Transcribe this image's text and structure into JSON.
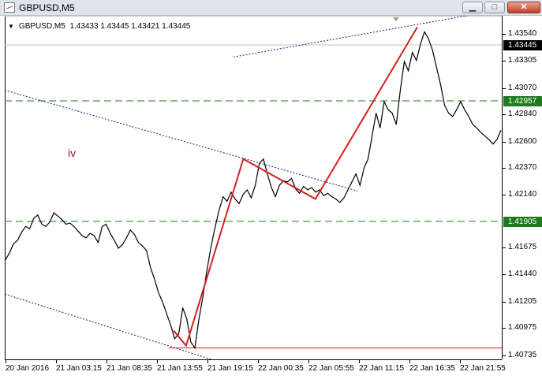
{
  "window": {
    "title": "GBPUSD,M5",
    "min_glyph": "▁",
    "max_glyph": "□",
    "close_glyph": "✕"
  },
  "info": {
    "symbol": "GBPUSD,M5",
    "ohlc": "1.43433 1.43445 1.43421 1.43445"
  },
  "annotation": {
    "wave": "iv"
  },
  "price_axis": {
    "levels": [
      "1.43540",
      "1.43305",
      "1.43070",
      "1.42840",
      "1.42600",
      "1.42370",
      "1.42140",
      "1.41675",
      "1.41440",
      "1.41205",
      "1.40975",
      "1.40735"
    ],
    "badges": [
      {
        "value": "1.43445",
        "bg": "#000000",
        "fg": "#ffffff"
      },
      {
        "value": "1.42957",
        "bg": "#1f7a1f",
        "fg": "#ffffff"
      },
      {
        "value": "1.41905",
        "bg": "#1f7a1f",
        "fg": "#ffffff"
      }
    ]
  },
  "time_axis": {
    "labels": [
      "20 Jan 2016",
      "21 Jan 03:15",
      "21 Jan 08:35",
      "21 Jan 13:55",
      "21 Jan 19:15",
      "22 Jan 00:35",
      "22 Jan 05:55",
      "22 Jan 11:15",
      "22 Jan 16:35",
      "22 Jan 21:55"
    ]
  },
  "colors": {
    "price_line": "#000000",
    "wave_line": "#d42020",
    "level_line": "#1f7a1f",
    "channel_line": "#1a1a8c",
    "support_line": "#d42020",
    "current_price_line": "#c0c0c0"
  },
  "chart_data": {
    "type": "line",
    "series": [
      {
        "values": [
          1.4157,
          1.4163,
          1.4171,
          1.4174,
          1.4181,
          1.4186,
          1.4184,
          1.4193,
          1.4196,
          1.4188,
          1.4186,
          1.419,
          1.4198,
          1.4195,
          1.4192,
          1.4188,
          1.4189,
          1.4186,
          1.4182,
          1.4178,
          1.4176,
          1.418,
          1.4178,
          1.4172,
          1.4186,
          1.4188,
          1.418,
          1.4174,
          1.4167,
          1.417,
          1.4176,
          1.4183,
          1.4179,
          1.4172,
          1.4169,
          1.4165,
          1.415,
          1.414,
          1.4128,
          1.412,
          1.411,
          1.41,
          1.4088,
          1.4092,
          1.4115,
          1.4105,
          1.4085,
          1.408,
          1.4105,
          1.4125,
          1.4148,
          1.4168,
          1.4185,
          1.42,
          1.4212,
          1.4208,
          1.4216,
          1.421,
          1.4206,
          1.4214,
          1.4218,
          1.4211,
          1.4222,
          1.4241,
          1.4245,
          1.4232,
          1.422,
          1.4212,
          1.4222,
          1.4226,
          1.4225,
          1.4228,
          1.4219,
          1.4215,
          1.4221,
          1.4218,
          1.422,
          1.4216,
          1.4218,
          1.4213,
          1.4215,
          1.4212,
          1.421,
          1.4207,
          1.4211,
          1.4218,
          1.4225,
          1.4232,
          1.4222,
          1.4237,
          1.4245,
          1.4265,
          1.4285,
          1.4272,
          1.4295,
          1.4288,
          1.4285,
          1.4275,
          1.4305,
          1.433,
          1.4322,
          1.4338,
          1.4331,
          1.4345,
          1.4356,
          1.435,
          1.434,
          1.4325,
          1.431,
          1.4292,
          1.4285,
          1.4282,
          1.4288,
          1.4295,
          1.4288,
          1.4282,
          1.4275,
          1.4272,
          1.4268,
          1.4265,
          1.4262,
          1.4258,
          1.4262,
          1.427
        ]
      }
    ],
    "ylim": [
      1.407,
      1.437
    ],
    "overlays": {
      "wave_points": [
        [
          0.34,
          1.4095
        ],
        [
          0.365,
          1.4082
        ],
        [
          0.48,
          1.4245
        ],
        [
          0.625,
          1.421
        ],
        [
          0.83,
          1.436
        ]
      ],
      "horizontal_levels": [
        1.42957,
        1.41905
      ],
      "current_price": 1.43445,
      "support": 1.408
    }
  }
}
